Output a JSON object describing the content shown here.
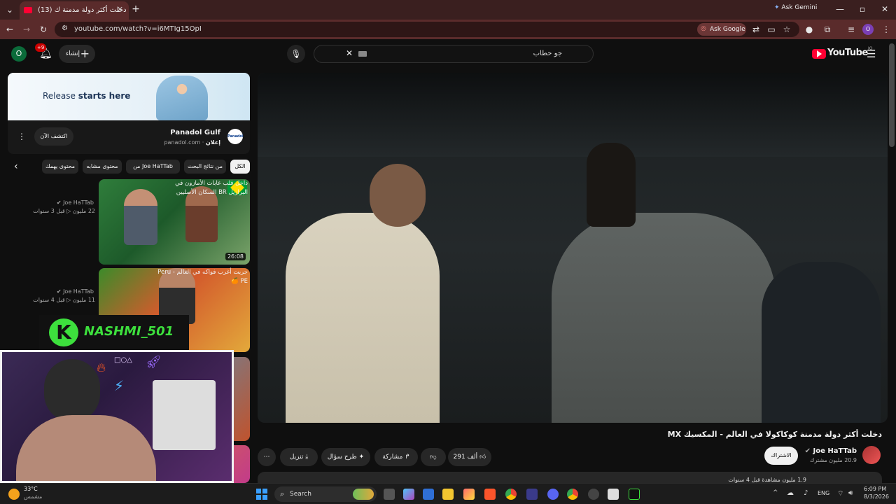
{
  "browser": {
    "tab_title": "(13) دخلت أكثر دولة مدمنة ك",
    "new_tab": "+",
    "url": "youtube.com/watch?v=i6MTIg15OpI",
    "ask_gemini": "Ask Gemini",
    "ask_google": "Ask Google",
    "profile_initial": "O"
  },
  "youtube": {
    "logo_text": "YouTube",
    "logo_sup": "JO",
    "search_value": "جو حطاب",
    "create_label": "إنشاء",
    "notif_count": "+9",
    "account_initial": "O"
  },
  "ad": {
    "banner_text_a": "Release ",
    "banner_text_b": "starts here",
    "advertiser": "Panadol Gulf",
    "sponsored": "إعلان",
    "domain": "panadol.com",
    "cta": "اكتشف الآن",
    "logo_text": "Panadol"
  },
  "chips": [
    "الكل",
    "من نتائج البحث",
    "من Joe HaTTab",
    "محتوى مشابه",
    "محتوى يهمك"
  ],
  "related": [
    {
      "title": "داخل قلب غابات الأمازون في البرازيل BR السكان الأصليين",
      "channel": "Joe HaTTab",
      "views": "22 مليون",
      "age": "قبل 3 سنوات",
      "duration": "26:08"
    },
    {
      "title": "جربت أغرب فواكه في العالم - Peru PE 🍊",
      "channel": "Joe HaTTab",
      "views": "11 مليون",
      "age": "قبل 4 سنوات"
    }
  ],
  "video": {
    "title": "دخلت أكثر دولة مدمنة كوكاكولا في العالم - المكسيك MX",
    "channel": "Joe HaTTab",
    "subscribers": "20.9 مليون مشترك",
    "subscribe": "الاشتراك",
    "likes": "291 ألف",
    "share": "مشاركة",
    "ask": "طرح سؤال",
    "download": "تنزيل",
    "description_peek": "1.9 مليون مشاهدة قبل 4 سنوات"
  },
  "overlay": {
    "streamer_name": "NASHMI_501",
    "badge_letter": "K"
  },
  "taskbar": {
    "weather_temp": "33°C",
    "weather_desc": "مشمس",
    "search_label": "Search",
    "language": "ENG",
    "time": "6:09 PM",
    "date": "8/3/2026"
  },
  "colors": {
    "yt_red": "#ff0033",
    "chrome_toolbar": "#5a2b2b",
    "chrome_tabstrip": "#3a1f1f",
    "page_bg": "#0f0f0f",
    "avatar_green": "#0b6b3a",
    "overlay_green": "#3de03d"
  }
}
